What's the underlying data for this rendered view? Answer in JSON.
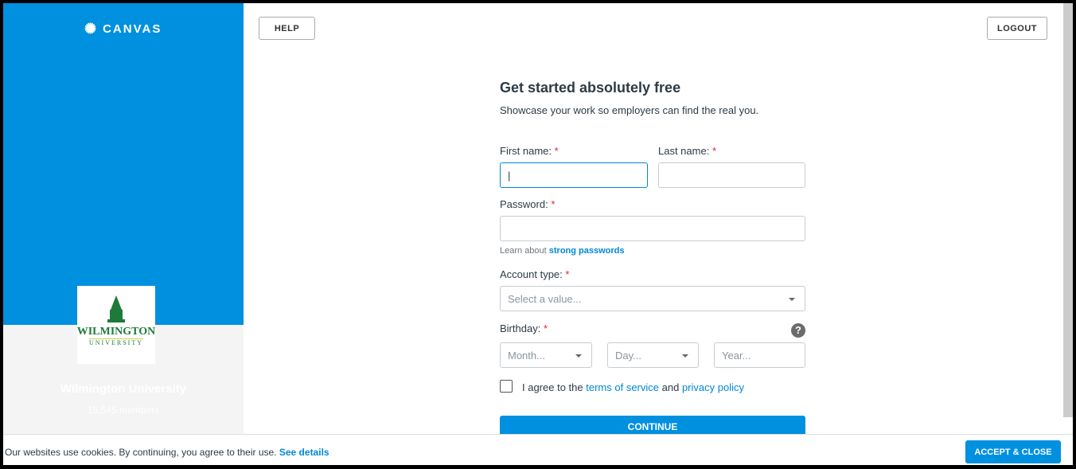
{
  "brand": "CANVAS",
  "header": {
    "help": "HELP",
    "logout": "LOGOUT"
  },
  "org": {
    "name": "Wilmington University",
    "members": "15,545 members",
    "logo_text": "WILMINGTON UNIVERSITY"
  },
  "form": {
    "title": "Get started absolutely free",
    "subtitle": "Showcase your work so employers can find the real you.",
    "first_name_label": "First name:",
    "last_name_label": "Last name:",
    "password_label": "Password:",
    "pw_hint": "Learn about",
    "pw_link": "strong passwords",
    "account_type_label": "Account type:",
    "account_type_placeholder": "Select a value...",
    "birthday_label": "Birthday:",
    "month": "Month...",
    "day": "Day...",
    "year": "Year...",
    "agree_prefix": "I agree to the",
    "terms": "terms of service",
    "and": "and",
    "privacy": "privacy policy",
    "continue": "CONTINUE",
    "required_mark": "*"
  },
  "cookie": {
    "text": "Our websites use cookies. By continuing, you agree to their use.",
    "link": "See details",
    "accept": "ACCEPT & CLOSE"
  },
  "colors": {
    "accent": "#0090e0",
    "required": "#e0242a"
  }
}
